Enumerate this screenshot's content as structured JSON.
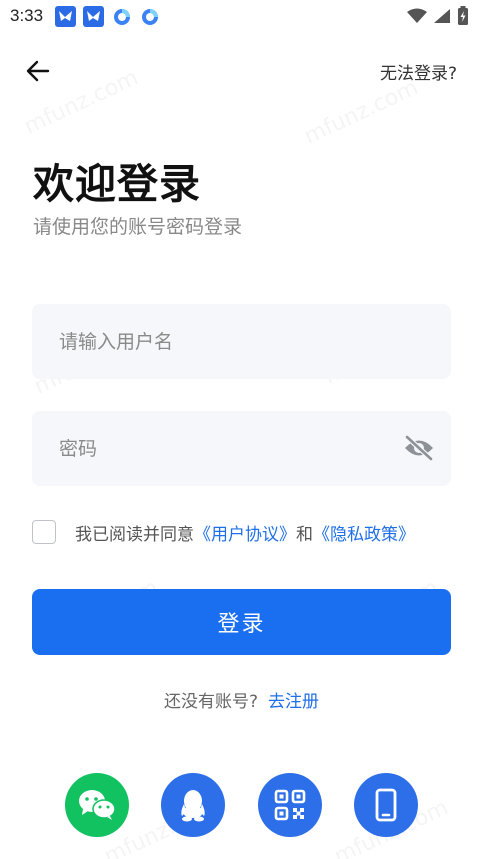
{
  "status_bar": {
    "time": "3:33",
    "app_icons": [
      "feishu-icon",
      "feishu-icon",
      "browser-icon",
      "browser-icon"
    ],
    "right_icons": [
      "wifi-icon",
      "signal-icon",
      "battery-icon"
    ]
  },
  "header": {
    "cannot_login": "无法登录?"
  },
  "title": {
    "welcome": "欢迎登录",
    "subtitle": "请使用您的账号密码登录"
  },
  "form": {
    "username_placeholder": "请输入用户名",
    "password_placeholder": "密码",
    "agreement_prefix": "我已阅读并同意",
    "user_agreement": "《用户协议》",
    "agreement_and": "和",
    "privacy_policy": "《隐私政策》",
    "login_label": "登录"
  },
  "register": {
    "prompt": "还没有账号?",
    "link": "去注册"
  },
  "social_logins": [
    "wechat-icon",
    "qq-icon",
    "qrcode-icon",
    "phone-icon"
  ],
  "watermark": "mfunz.com",
  "colors": {
    "primary": "#1a6ff0",
    "wechat": "#12c160",
    "social_blue": "#2d6fe8",
    "input_bg": "#f5f7fa",
    "link": "#1f6fe8"
  }
}
